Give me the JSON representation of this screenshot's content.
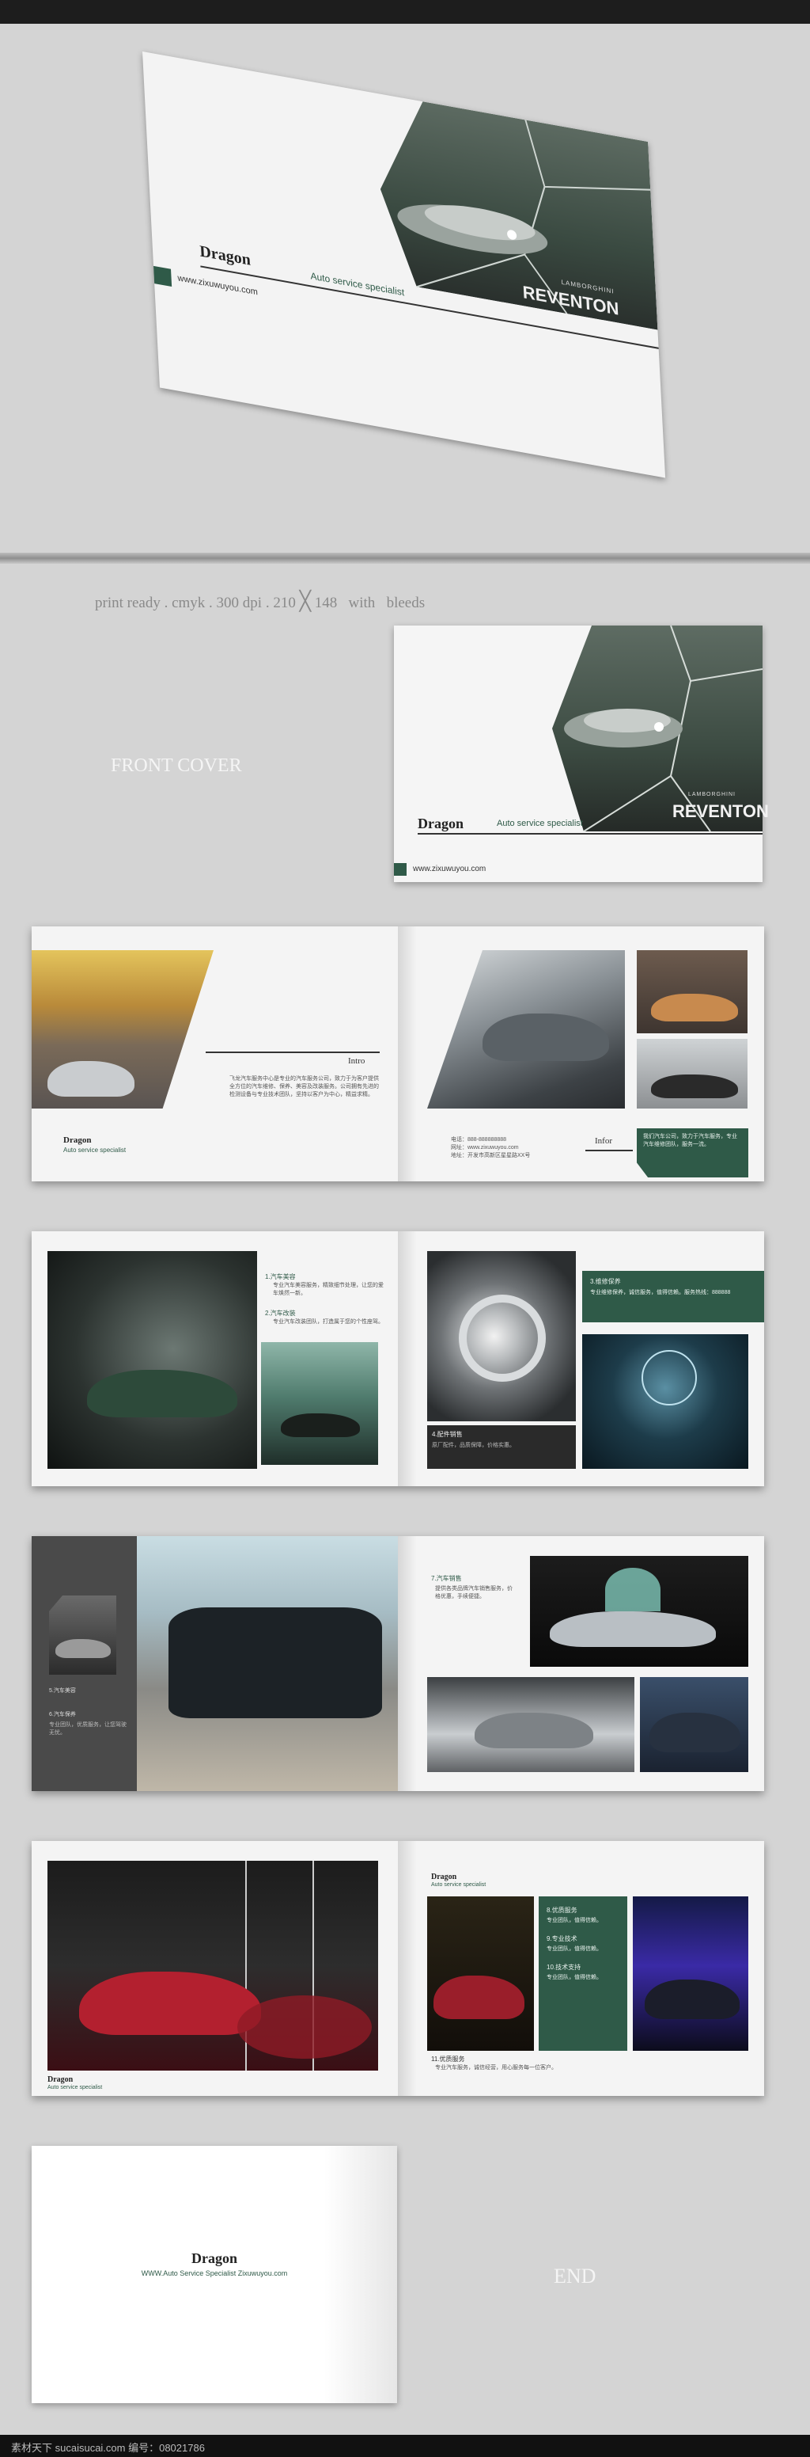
{
  "cover": {
    "brand": "Dragon",
    "tagline": "Auto service specialist",
    "website": "www.zixuwuyou.com",
    "car_model": "REVENTON",
    "car_make": "LAMBORGHINI"
  },
  "specs": {
    "line": "print ready . cmyk . 300 dpi . 210",
    "times": "╳",
    "size2": "148",
    "with": "with",
    "bleeds": "bleeds"
  },
  "front_cover_label": "FRONT COVER",
  "spread1": {
    "intro_label": "Intro",
    "info_label": "Infor",
    "intro_text": "飞龙汽车服务中心是专业的汽车服务公司，致力于为客户提供全方位的汽车维修、保养、美容及改装服务。公司拥有先进的检测设备与专业技术团队，坚持以客户为中心，精益求精。",
    "info_text": "电话：888-888888888\n网址：www.zixuwuyou.com\n地址：开发市高新区星星路XX号",
    "green_text": "我们汽车公司，致力于汽车服务，专业汽车维修团队，服务一流。"
  },
  "spread2": {
    "heading1": "1.汽车美容",
    "heading2": "2.汽车改装",
    "body1": "专业汽车美容服务，精致细节处理，让您的爱车焕然一新。",
    "body2": "专业汽车改装团队，打造属于您的个性座驾。",
    "green_heading": "3.维修保养",
    "green_body": "专业维修保养，诚信服务，值得信赖。服务热线：888888",
    "dark_heading": "4.配件销售",
    "dark_body": "原厂配件，品质保障，价格实惠。"
  },
  "spread3": {
    "heading1": "5.汽车美容",
    "heading2": "6.汽车保养",
    "body": "专业团队，优质服务，让您驾驶无忧。",
    "right_heading": "7.汽车销售",
    "right_body": "提供各类品牌汽车销售服务，价格优惠，手续便捷。"
  },
  "spread4": {
    "brand": "Dragon",
    "tagline": "Auto service specialist",
    "footer_heading": "11.优质服务",
    "footer_body": "专业汽车服务，诚信经营，用心服务每一位客户。",
    "green_h1": "8.优质服务",
    "green_h2": "9.专业技术",
    "green_h3": "10.技术支持",
    "green_body": "专业团队，值得信赖。"
  },
  "back": {
    "brand": "Dragon",
    "line": "WWW.Auto Service Specialist Zixuwuyou.com",
    "end": "END"
  },
  "watermark": {
    "text": "素材天下 sucaisucai.com  编号：08021786"
  },
  "colors": {
    "accent_green": "#2f5a48",
    "background": "#d4d4d4",
    "dark_panel": "#2b2b2b"
  }
}
